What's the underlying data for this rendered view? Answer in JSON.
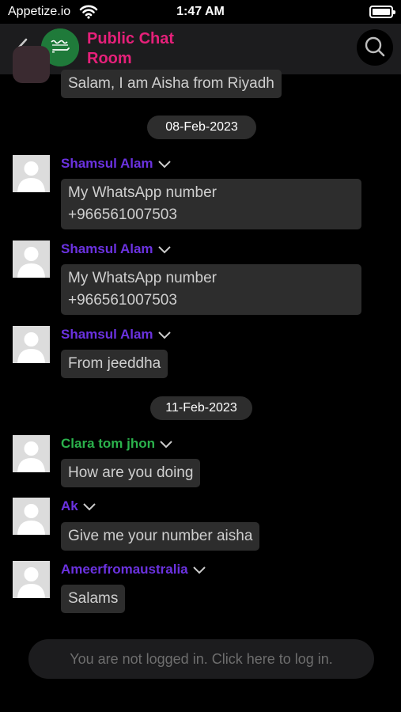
{
  "status_bar": {
    "carrier": "Appetize.io",
    "time": "1:47 AM"
  },
  "header": {
    "title": "Public Chat Room"
  },
  "messages_top": {
    "partial_text": "Salam, I am Aisha from Riyadh"
  },
  "dates": [
    "08-Feb-2023",
    "11-Feb-2023"
  ],
  "messages": [
    {
      "sender": "Shamsul Alam",
      "lines": [
        "My WhatsApp number",
        "+966561007503"
      ]
    },
    {
      "sender": "Shamsul Alam",
      "lines": [
        "My WhatsApp number",
        "+966561007503"
      ]
    },
    {
      "sender": "Shamsul Alam",
      "lines": [
        "From jeeddha"
      ]
    },
    {
      "sender": "Clara tom jhon",
      "lines": [
        "How are you doing"
      ]
    },
    {
      "sender": "Ak",
      "lines": [
        "Give me your number aisha"
      ]
    },
    {
      "sender": "Ameerfromaustralia",
      "lines": [
        "Salams"
      ]
    }
  ],
  "footer": {
    "login_prompt": "You are not logged in. Click here to log in."
  },
  "colors": {
    "title": "#e6207a",
    "sender_purple": "#6b32e0",
    "sender_green": "#2bb24c",
    "bubble": "#2d2d2d"
  },
  "icons": [
    "wifi-icon",
    "battery-icon",
    "back-chevron-icon",
    "saudi-flag-avatar",
    "search-icon",
    "default-user-icon",
    "chevron-down-icon"
  ]
}
